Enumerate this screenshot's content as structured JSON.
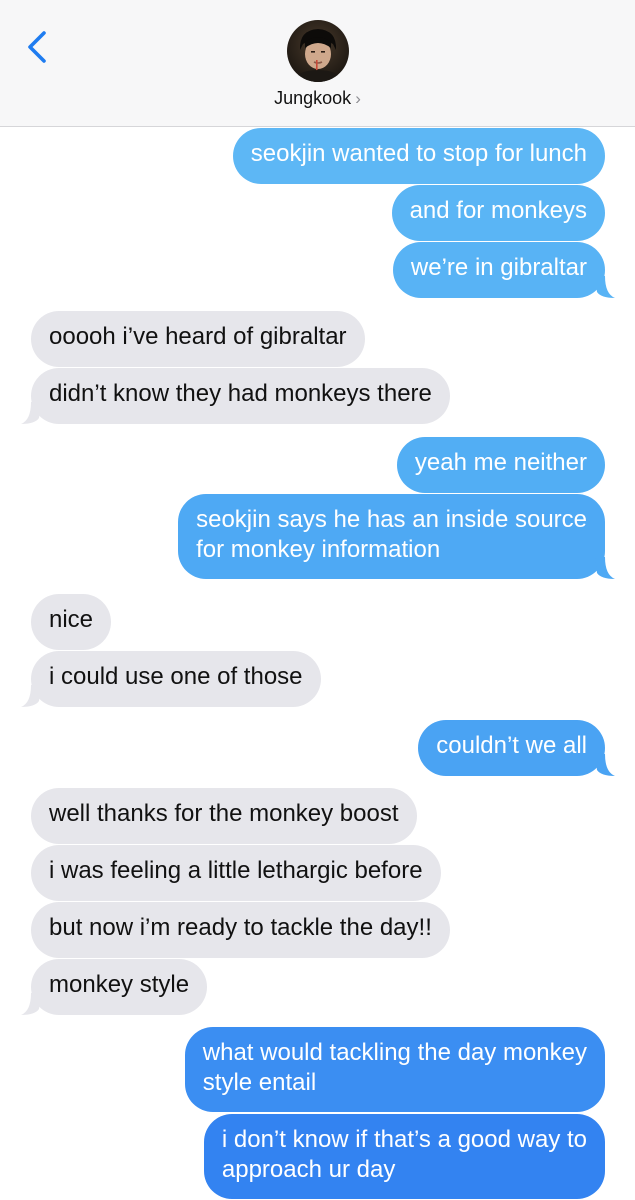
{
  "header": {
    "contact_name": "Jungkook",
    "chevron": "›",
    "back_icon": "chevron-left-icon"
  },
  "colors": {
    "sent_top": "#5bb6f5",
    "sent_bottom": "#2f7ff0",
    "received": "#e6e6eb",
    "ios_blue": "#1f7cf0",
    "header_bg": "#f7f7f8"
  },
  "messages": [
    {
      "from": "me",
      "lines": [
        "seokjin wanted to stop for lunch"
      ]
    },
    {
      "from": "me",
      "lines": [
        "and for monkeys"
      ]
    },
    {
      "from": "me",
      "lines": [
        "we’re in gibraltar"
      ]
    },
    {
      "from": "them",
      "lines": [
        "ooooh i’ve heard of gibraltar"
      ]
    },
    {
      "from": "them",
      "lines": [
        "didn’t know they had monkeys there"
      ]
    },
    {
      "from": "me",
      "lines": [
        "yeah me neither"
      ]
    },
    {
      "from": "me",
      "lines": [
        "seokjin says he has an inside source",
        "for monkey information"
      ]
    },
    {
      "from": "them",
      "lines": [
        "nice"
      ]
    },
    {
      "from": "them",
      "lines": [
        "i could use one of those"
      ]
    },
    {
      "from": "me",
      "lines": [
        "couldn’t we all"
      ]
    },
    {
      "from": "them",
      "lines": [
        "well thanks for the monkey boost"
      ]
    },
    {
      "from": "them",
      "lines": [
        "i was feeling a little lethargic before"
      ]
    },
    {
      "from": "them",
      "lines": [
        "but now i’m ready to tackle the day!!"
      ]
    },
    {
      "from": "them",
      "lines": [
        "monkey style"
      ]
    },
    {
      "from": "me",
      "lines": [
        "what would tackling the day monkey",
        "style entail"
      ]
    },
    {
      "from": "me",
      "lines": [
        "i don’t know if that’s a good way to",
        "approach ur day"
      ]
    }
  ]
}
